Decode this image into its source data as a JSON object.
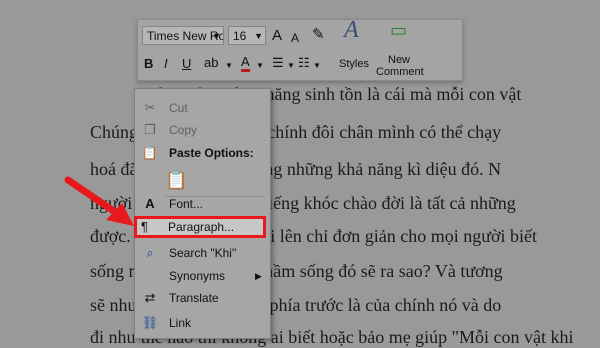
{
  "document": {
    "lines": [
      "Khi sinh ra, bản năng sinh tồn là cái mà mỗi con vật",
      "Chúng ta đứng lên bằng chính đôi chân mình có thể chạy",
      "hoá đã ban tặng cho chúng những khả năng kì diệu đó. N",
      "người cũng vậy, sinh ra tiếng khóc chào đời là tất cả những",
      "được. Nhưng đứng dậy đi lên chỉ đơn giản cho mọi người biết",
      "sống mãnh liệt. Những mầm sống đó sẽ ra sao? Và tương",
      "sẽ như thế nào? Sự sống phía trước là của chính nó và do",
      "đi như thế nào thì không ai biết hoặc bảo mẹ giúp \"Mỗi con vật khi"
    ]
  },
  "mini_toolbar": {
    "font_name": "Times New Ro",
    "font_size": "16",
    "grow_font": "A",
    "shrink_font": "A",
    "styles_label": "Styles",
    "new_comment_line1": "New",
    "new_comment_line2": "Comment",
    "bold": "B",
    "italic": "I",
    "underline": "U",
    "font_color": "A"
  },
  "context_menu": {
    "cut": "Cut",
    "copy": "Copy",
    "paste_options": "Paste Options:",
    "font": "Font...",
    "paragraph": "Paragraph...",
    "search": "Search \"Khi\"",
    "synonyms": "Synonyms",
    "translate": "Translate",
    "link": "Link"
  },
  "colors": {
    "highlight_border": "#e8191c",
    "arrow": "#e8191c"
  }
}
